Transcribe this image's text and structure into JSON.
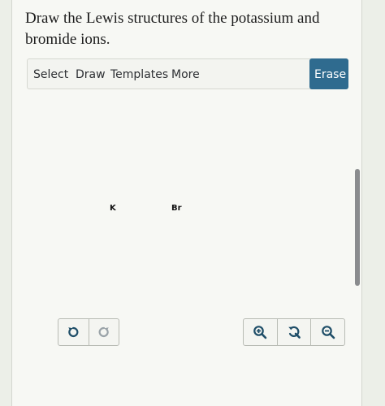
{
  "question": {
    "text": "Draw the Lewis structures of the potassium and bromide ions."
  },
  "toolbar": {
    "select_label": "Select",
    "draw_label": "Draw",
    "templates_label": "Templates",
    "more_label": "More",
    "erase_label": "Erase"
  },
  "canvas": {
    "atoms": [
      {
        "symbol": "K"
      },
      {
        "symbol": "Br"
      }
    ]
  },
  "controls": {
    "undo_icon": "undo-icon",
    "redo_icon": "redo-icon",
    "zoom_in_icon": "zoom-in-icon",
    "reset_zoom_icon": "reset-zoom-icon",
    "zoom_out_icon": "zoom-out-icon"
  },
  "colors": {
    "accent": "#2f6b8f",
    "icon_active": "#1f4e68",
    "icon_disabled": "#9aa3a8"
  }
}
